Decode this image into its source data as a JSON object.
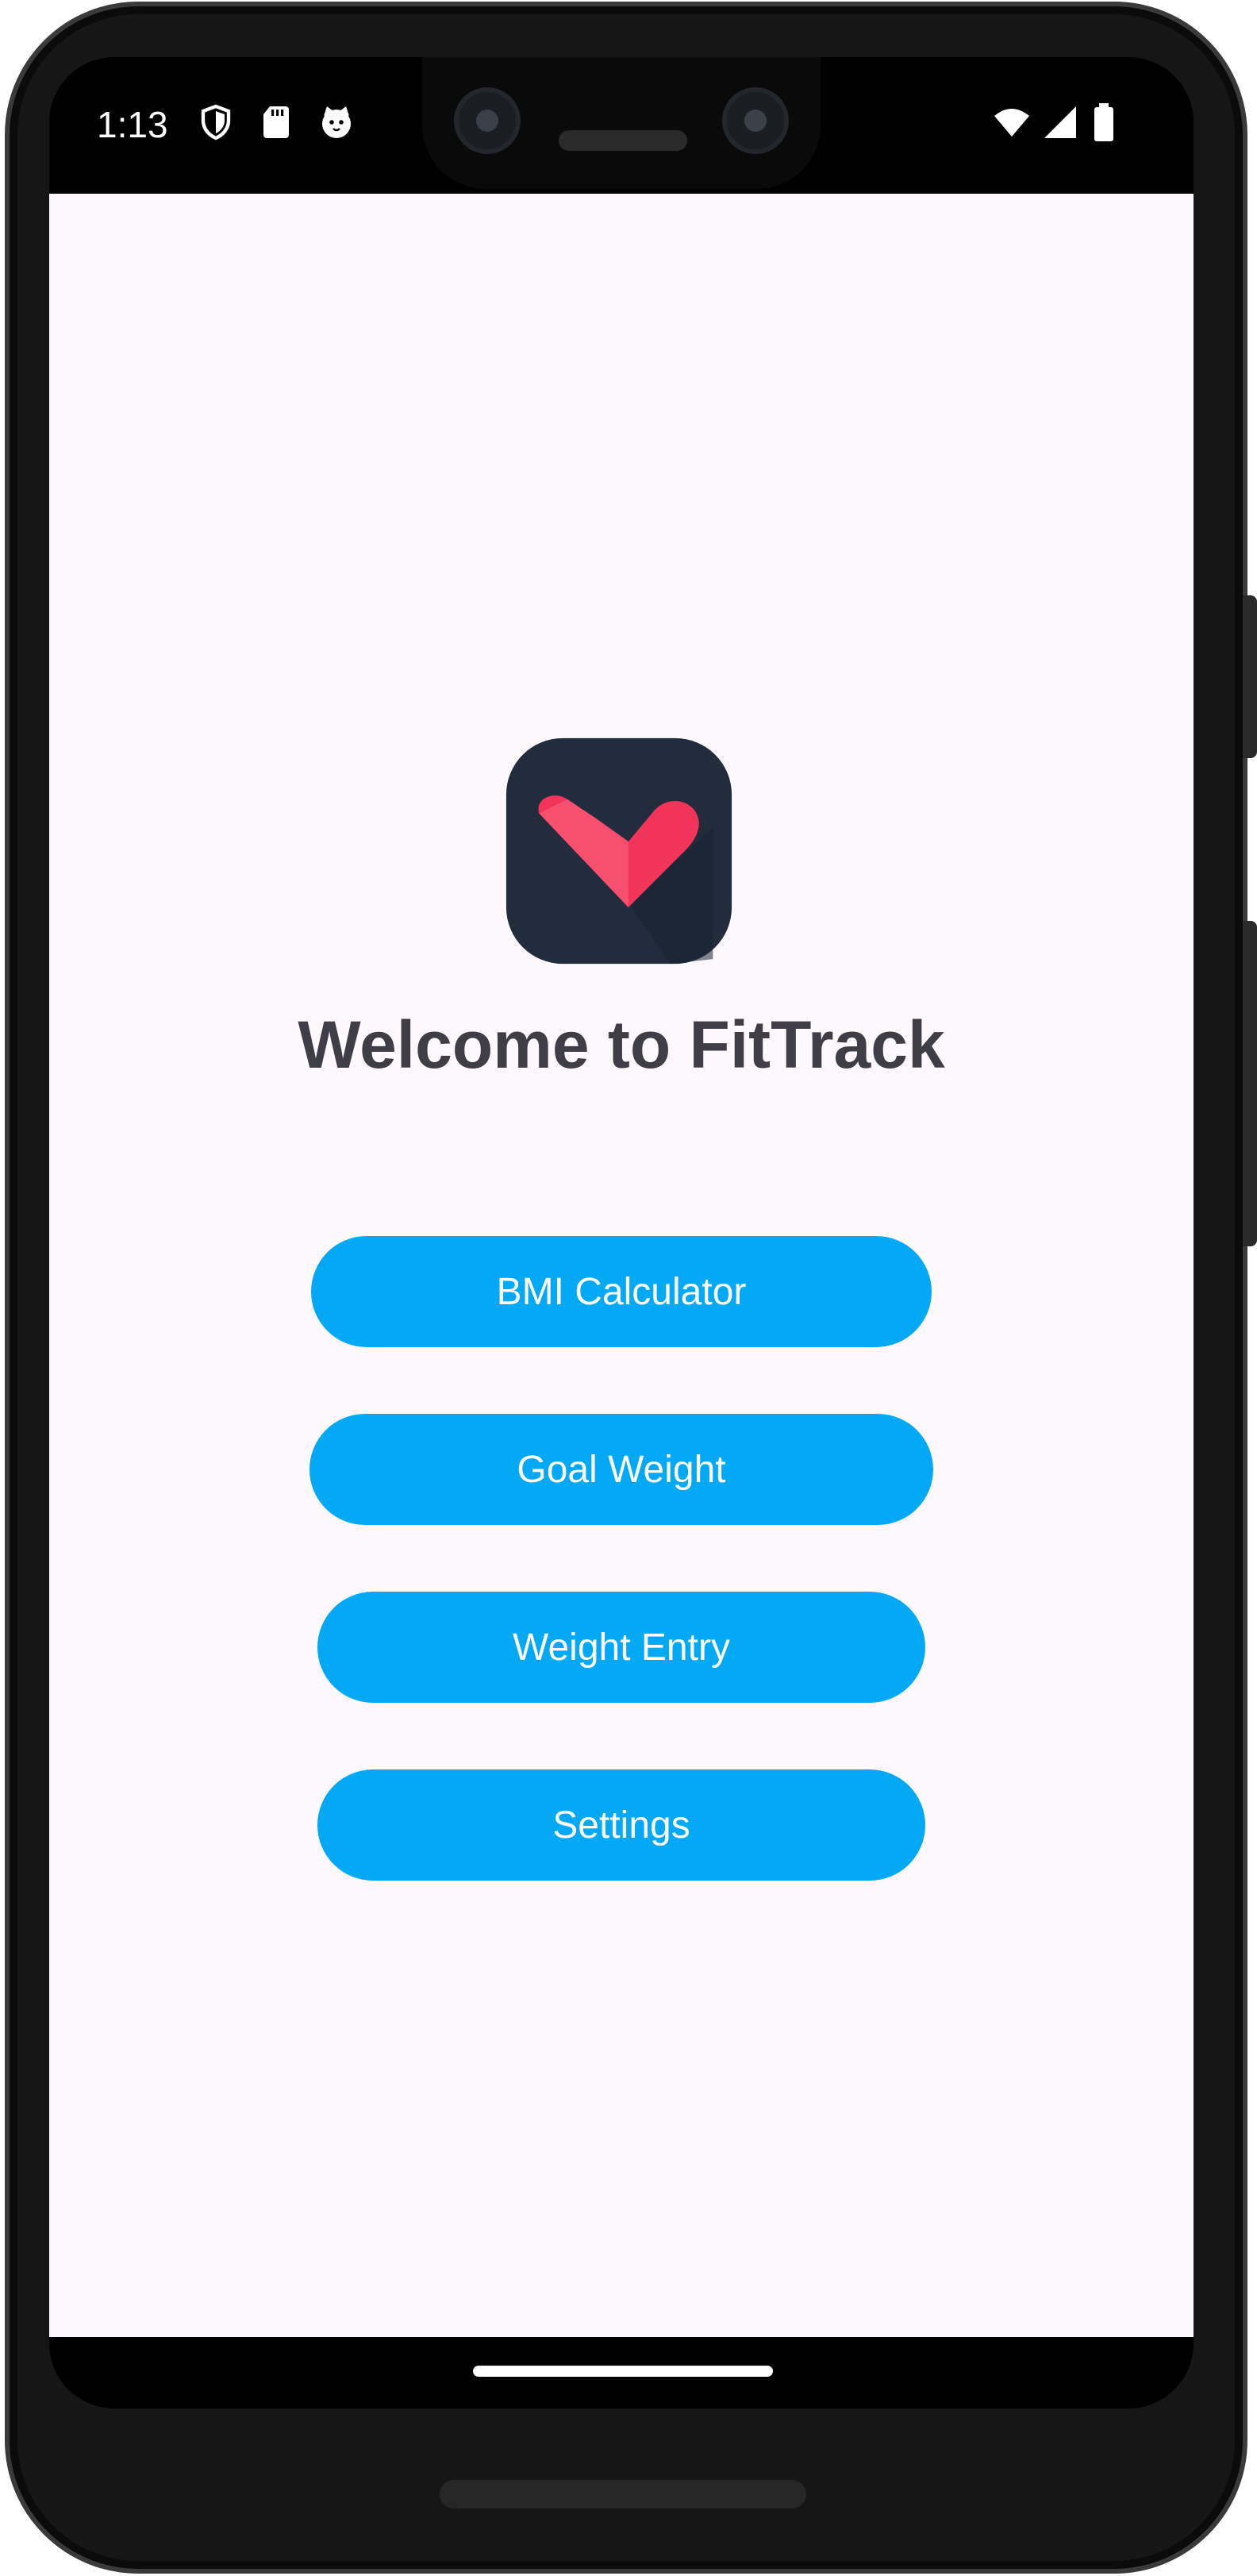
{
  "status_bar": {
    "time": "1:13",
    "left_icons": [
      "shield-icon",
      "sd-card-icon",
      "cat-face-icon"
    ],
    "right_icons": [
      "wifi-icon",
      "signal-icon",
      "battery-icon"
    ]
  },
  "app": {
    "background_color": "#fcf8fb",
    "logo_icon": "heart-check-logo",
    "logo_colors": {
      "tile": "#222c3c",
      "mark": "#f0345a"
    },
    "title": "Welcome to FitTrack",
    "accent_color": "#03a9f4",
    "buttons": [
      {
        "label": "BMI Calculator"
      },
      {
        "label": "Goal Weight"
      },
      {
        "label": "Weight Entry"
      },
      {
        "label": "Settings"
      }
    ]
  }
}
